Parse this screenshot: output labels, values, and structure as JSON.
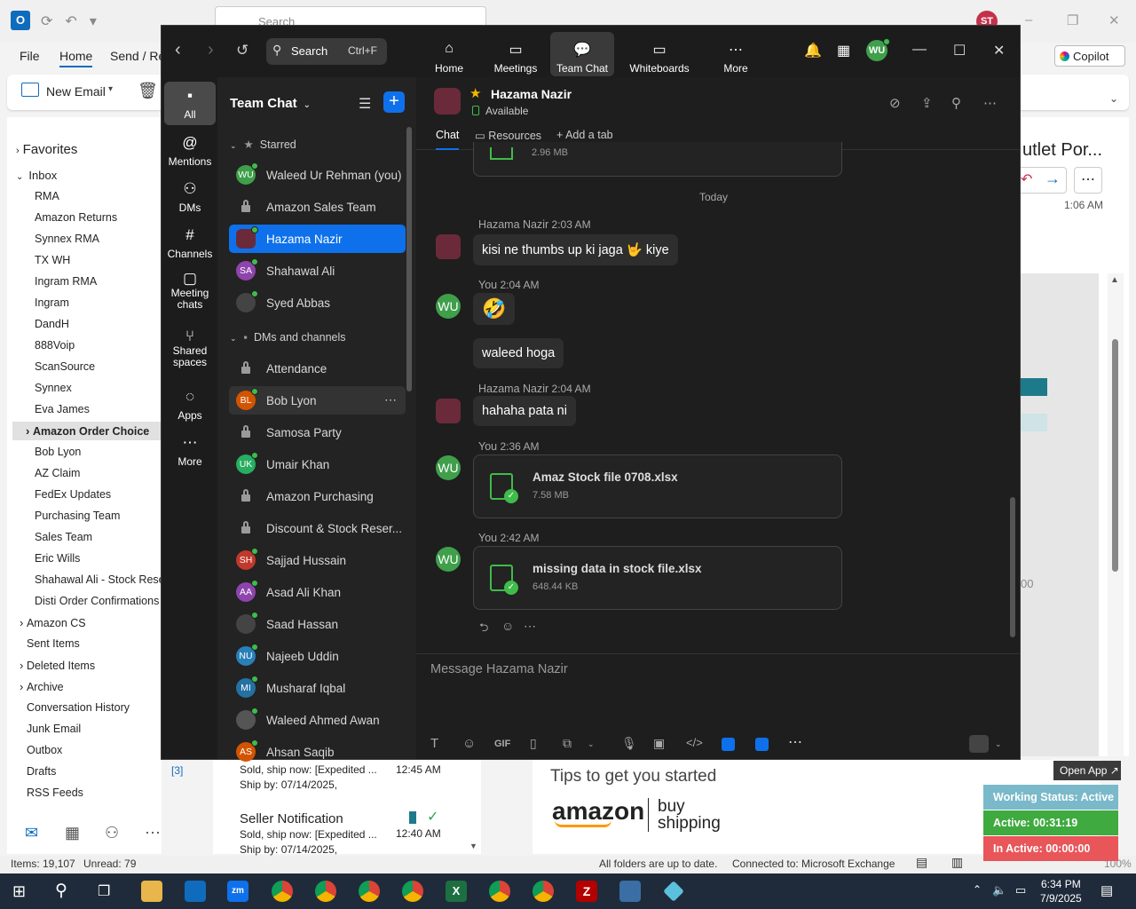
{
  "outlook": {
    "search_placeholder": "Search",
    "avatar": "ST",
    "menu": [
      "File",
      "Home",
      "Send / Re"
    ],
    "new_email": "New Email",
    "copilot": "Copilot",
    "favorites": "Favorites",
    "inbox": "Inbox",
    "folders": [
      "RMA",
      "Amazon Returns",
      "Synnex RMA",
      "TX WH",
      "Ingram RMA",
      "Ingram",
      "DandH",
      "888Voip",
      "ScanSource",
      "Synnex",
      "Eva James",
      "Amazon Order Choice",
      "Bob Lyon",
      "AZ Claim",
      "FedEx Updates",
      "Purchasing Team",
      "Sales Team",
      "Eric Wills",
      "Shahawal Ali - Stock Reserv",
      "Disti Order Confirmations",
      "Amazon CS",
      "Sent Items",
      "Deleted Items",
      "Archive",
      "Conversation History",
      "Junk Email",
      "Outbox",
      "Drafts",
      "RSS Feeds"
    ],
    "drafts_count": "[3]",
    "reading_title": "utlet Por...",
    "reading_time": "1:06 AM",
    "reading_00": "00",
    "mail_items": [
      {
        "sender": "",
        "subject": "Sold, ship now: [Expedited ...",
        "ship_by": "Ship by: 07/14/2025,",
        "time": "12:45 AM"
      },
      {
        "sender": "Seller Notification",
        "subject": "Sold, ship now: [Expedited ...",
        "ship_by": "Ship by: 07/14/2025,",
        "time": "12:40 AM"
      }
    ],
    "tips": "Tips to get you started",
    "amazon": "amazon",
    "buy_shipping_1": "buy",
    "buy_shipping_2": "shipping",
    "status_items": "Items: 19,107",
    "status_unread": "Unread: 79",
    "status_sync": "All folders are up to date.",
    "status_conn": "Connected to: Microsoft Exchange",
    "zoom_pct": "100%"
  },
  "work_status": {
    "open_app": "Open App ↗",
    "status": "Working Status: Active",
    "active": "Active: 00:31:19",
    "inactive": "In Active: 00:00:00"
  },
  "taskbar": {
    "time": "6:34 PM",
    "date": "7/9/2025"
  },
  "zoom": {
    "search": "Search",
    "search_shortcut": "Ctrl+F",
    "tabs": [
      "Home",
      "Meetings",
      "Team Chat",
      "Whiteboards",
      "More"
    ],
    "user_initials": "WU",
    "rail": [
      "All",
      "Mentions",
      "DMs",
      "Channels",
      "Meeting chats",
      "Shared spaces",
      "Apps",
      "More"
    ],
    "list_title": "Team Chat",
    "sections": {
      "starred": "Starred",
      "dms": "DMs and channels"
    },
    "starred": [
      {
        "name": "Waleed Ur Rehman (you)",
        "initials": "WU",
        "color": "#3f9f4b"
      },
      {
        "name": "Amazon Sales Team",
        "initials": "",
        "color": ""
      },
      {
        "name": "Hazama Nazir",
        "initials": "",
        "color": "#6b2a3a"
      },
      {
        "name": "Shahawal Ali",
        "initials": "SA",
        "color": "#8e44ad"
      },
      {
        "name": "Syed Abbas",
        "initials": "",
        "color": "#444"
      }
    ],
    "dms": [
      {
        "name": "Attendance",
        "initials": "",
        "color": ""
      },
      {
        "name": "Bob Lyon",
        "initials": "BL",
        "color": "#d35400"
      },
      {
        "name": "Samosa Party",
        "initials": "",
        "color": ""
      },
      {
        "name": "Umair Khan",
        "initials": "UK",
        "color": "#27ae60"
      },
      {
        "name": "Amazon Purchasing",
        "initials": "",
        "color": ""
      },
      {
        "name": "Discount & Stock Reser...",
        "initials": "",
        "color": ""
      },
      {
        "name": "Sajjad Hussain",
        "initials": "SH",
        "color": "#c0392b"
      },
      {
        "name": "Asad Ali Khan",
        "initials": "AA",
        "color": "#8e44ad"
      },
      {
        "name": "Saad Hassan",
        "initials": "",
        "color": "#444"
      },
      {
        "name": "Najeeb Uddin",
        "initials": "NU",
        "color": "#2980b9"
      },
      {
        "name": "Musharaf Iqbal",
        "initials": "MI",
        "color": "#2471a3"
      },
      {
        "name": "Waleed Ahmed Awan",
        "initials": "",
        "color": "#555"
      },
      {
        "name": "Ahsan Saqib",
        "initials": "AS",
        "color": "#d35400"
      }
    ],
    "chat": {
      "name": "Hazama Nazir",
      "status": "Available",
      "tabs": [
        "Chat",
        "Resources",
        "Add a tab"
      ],
      "prev_file_size": "2.96 MB",
      "today": "Today",
      "messages": [
        {
          "who": "Hazama Nazir",
          "time": "2:03 AM",
          "text": "kisi ne thumbs up ki jaga 🤟 kiye"
        },
        {
          "who": "You",
          "time": "2:04 AM",
          "text": "🤣",
          "text2": "waleed hoga"
        },
        {
          "who": "Hazama Nazir",
          "time": "2:04 AM",
          "text": "hahaha pata ni"
        },
        {
          "who": "You",
          "time": "2:36 AM",
          "file": "Amaz Stock file 0708.xlsx",
          "size": "7.58 MB"
        },
        {
          "who": "You",
          "time": "2:42 AM",
          "file": "missing data in stock file.xlsx",
          "size": "648.44 KB"
        }
      ],
      "composer_placeholder": "Message Hazama Nazir"
    }
  }
}
